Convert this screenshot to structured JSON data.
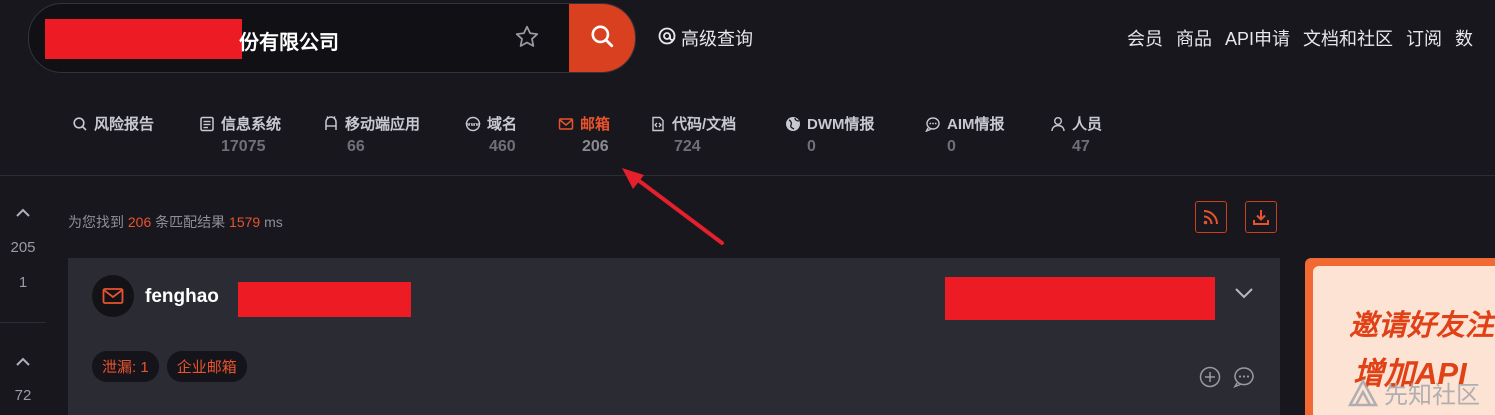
{
  "search": {
    "query_visible_text": "份有限公司",
    "button_icon": "search-icon",
    "favorite_icon": "star-icon"
  },
  "advanced_search": {
    "icon": "at-icon",
    "label": "高级查询"
  },
  "top_nav": [
    "会员",
    "商品",
    "API申请",
    "文档和社区",
    "订阅",
    "数"
  ],
  "categories": [
    {
      "icon": "search-icon",
      "label": "风险报告",
      "count": ""
    },
    {
      "icon": "document-list-icon",
      "label": "信息系统",
      "count": "17075"
    },
    {
      "icon": "mobile-app-icon",
      "label": "移动端应用",
      "count": "66"
    },
    {
      "icon": "www-icon",
      "label": "域名",
      "count": "460"
    },
    {
      "icon": "mail-icon",
      "label": "邮箱",
      "count": "206",
      "active": true
    },
    {
      "icon": "code-doc-icon",
      "label": "代码/文档",
      "count": "724"
    },
    {
      "icon": "globe-icon",
      "label": "DWM情报",
      "count": "0"
    },
    {
      "icon": "chat-icon",
      "label": "AIM情报",
      "count": "0"
    },
    {
      "icon": "person-icon",
      "label": "人员",
      "count": "47"
    }
  ],
  "votes": [
    {
      "count1": "205",
      "count2": "1"
    },
    {
      "count1": "72"
    }
  ],
  "results": {
    "prefix": "为您找到",
    "count": "206",
    "middle": "条匹配结果",
    "time": "1579",
    "unit": "ms"
  },
  "toolbar": {
    "rss_icon": "rss-icon",
    "download_icon": "download-icon"
  },
  "result_card": {
    "title": "fenghao",
    "tags": [
      "泄漏: 1",
      "企业邮箱"
    ]
  },
  "promo": {
    "line1": "邀请好友注",
    "line2": "增加API"
  },
  "watermark": "先知社区",
  "colors": {
    "accent": "#e8532d",
    "redaction": "#ed1c24",
    "background": "#17171d",
    "card": "#2a2b33"
  }
}
